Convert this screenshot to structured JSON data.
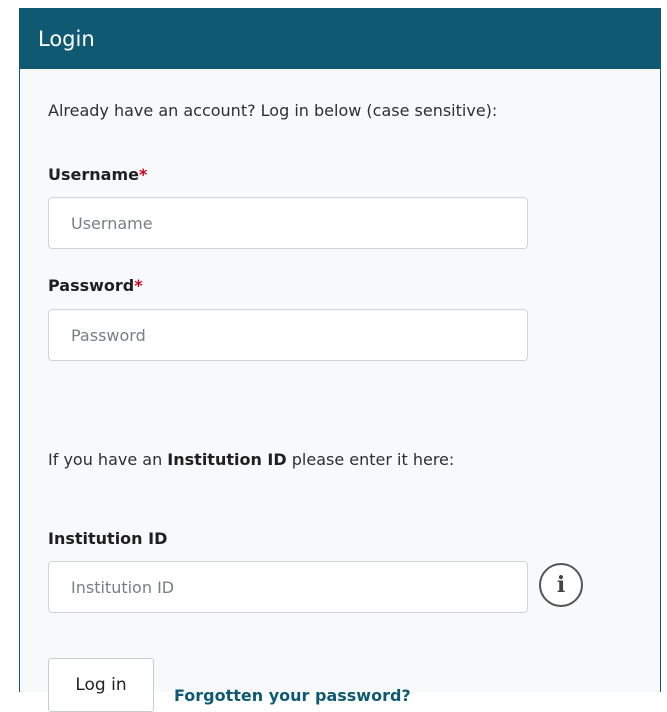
{
  "header": {
    "title": "Login"
  },
  "form": {
    "intro": "Already have an account? Log in below (case sensitive):",
    "username": {
      "label": "Username",
      "required_mark": "*",
      "placeholder": "Username",
      "value": ""
    },
    "password": {
      "label": "Password",
      "required_mark": "*",
      "placeholder": "Password",
      "value": ""
    },
    "institution_note": {
      "prefix": "If you have an ",
      "bold": "Institution ID",
      "suffix": " please enter it here:"
    },
    "institution": {
      "label": "Institution ID",
      "placeholder": "Institution ID",
      "value": "",
      "info_glyph": "i"
    },
    "login_button": "Log in",
    "forgot_link": "Forgotten your password?"
  },
  "colors": {
    "header_bg": "#0f5a72",
    "required": "#d0021b",
    "link": "#0f5a72"
  }
}
